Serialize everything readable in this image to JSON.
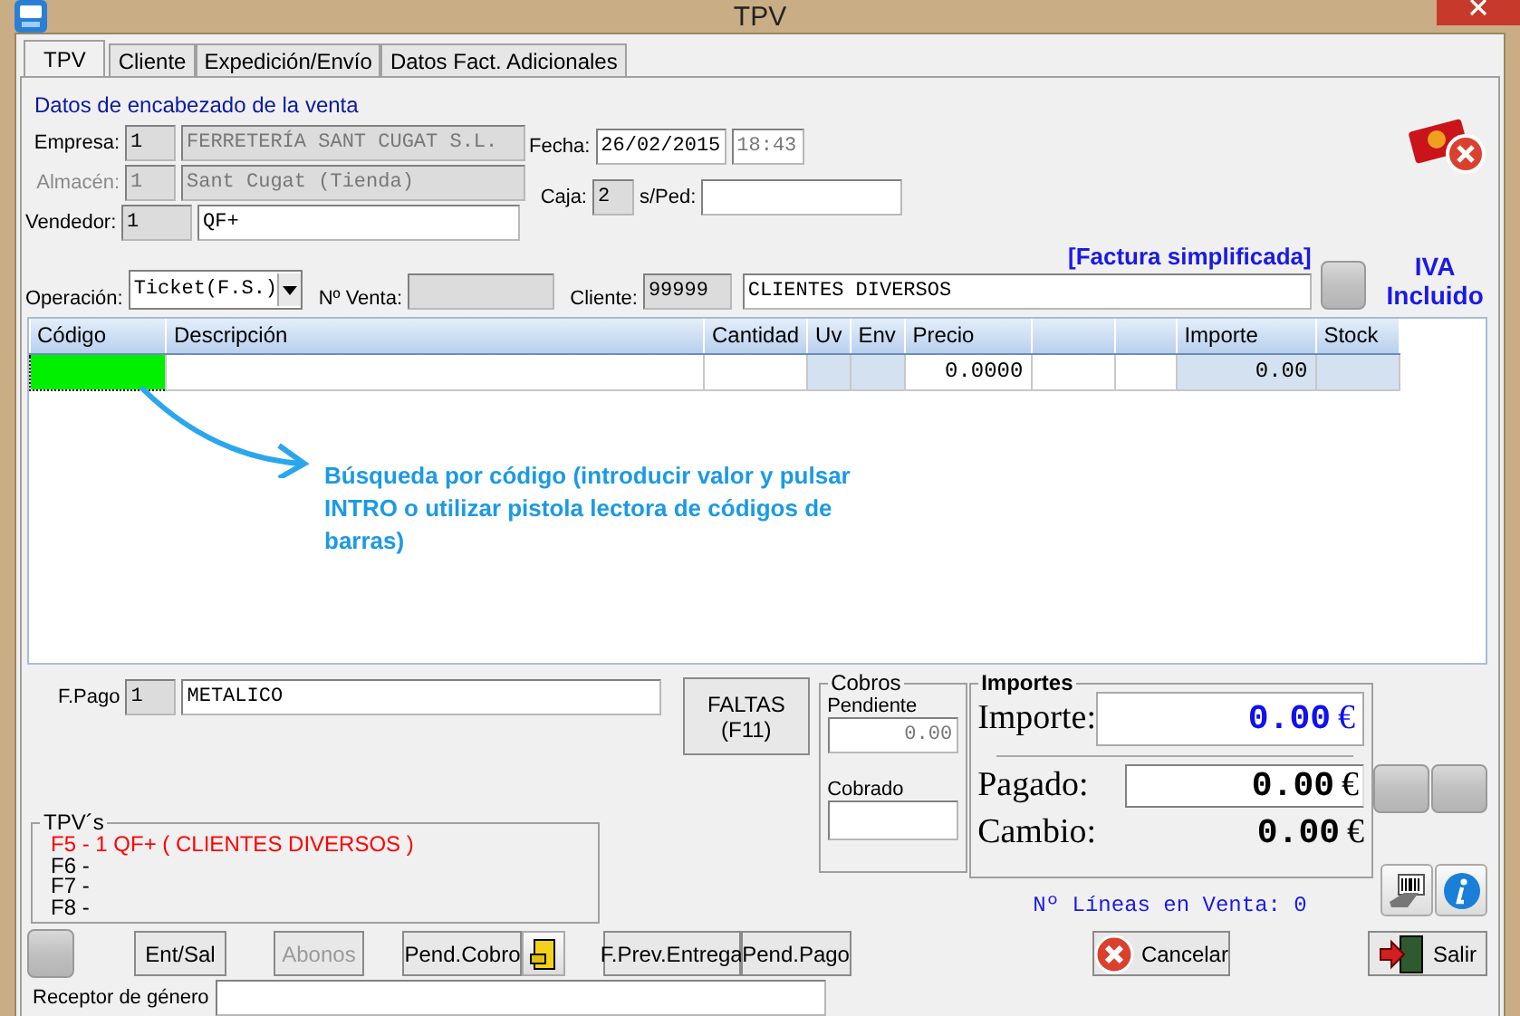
{
  "window": {
    "title": "TPV"
  },
  "tabs": [
    {
      "label": "TPV",
      "selected": true
    },
    {
      "label": "Cliente",
      "selected": false
    },
    {
      "label": "Expedición/Envío",
      "selected": false
    },
    {
      "label": "Datos Fact. Adicionales",
      "selected": false
    }
  ],
  "header": {
    "title": "Datos de encabezado de la venta",
    "fields": [
      {
        "label": "Empresa:",
        "code": "1",
        "name": "FERRETERÍA SANT CUGAT S.L.",
        "disabled": false
      },
      {
        "label": "Almacén:",
        "code": "1",
        "name": "Sant Cugat (Tienda)",
        "disabled": true
      },
      {
        "label": "Vendedor:",
        "code": "1",
        "name": "QF+",
        "disabled": false
      }
    ],
    "fecha": {
      "label": "Fecha:",
      "date": "26/02/2015",
      "time": "18:43"
    },
    "caja": {
      "label": "Caja:",
      "value": "2"
    },
    "pedido": {
      "label": "s/Ped:"
    },
    "operacion": {
      "label": "Operación:",
      "value": "Ticket(F.S.)"
    },
    "num_venta": {
      "label": "Nº Venta:"
    },
    "cliente": {
      "label": "Cliente:",
      "code": "99999",
      "name": "CLIENTES DIVERSOS"
    },
    "invoice_type": "[Factura simplificada]",
    "iva": "IVA Incluido"
  },
  "table": {
    "columns": [
      {
        "label": "Código"
      },
      {
        "label": "Descripción"
      },
      {
        "label": "Cantidad"
      },
      {
        "label": "Uv"
      },
      {
        "label": "Env"
      },
      {
        "label": "Precio"
      },
      {},
      {},
      {
        "label": "Importe"
      },
      {
        "label": "Stock"
      }
    ],
    "rows": [
      {
        "cells": [
          null,
          null,
          null,
          null,
          null,
          "0.0000",
          null,
          null,
          "0.00",
          null
        ]
      }
    ],
    "hint": "Búsqueda por código (introducir valor y pulsar INTRO o utilizar pistola lectora de códigos de barras)"
  },
  "payment": {
    "label": "F.Pago",
    "code": "1",
    "name": "METALICO"
  },
  "faltas_button": "FALTAS (F11)",
  "cobros": {
    "title": "Cobros",
    "pendiente_label": "Pendiente",
    "pendiente": "0.00",
    "cobrado_label": "Cobrado"
  },
  "importes": {
    "title": "Importes",
    "rows": [
      {
        "kind": "total",
        "label": "Importe:",
        "value": "0.00",
        "currency": "€"
      },
      {
        "kind": "input",
        "label": "Pagado:",
        "value": "0.00",
        "currency": "€"
      },
      {
        "kind": "plain",
        "label": "Cambio:",
        "value": "0.00",
        "currency": "€"
      }
    ]
  },
  "lines_count": "Nº Líneas en Venta: 0",
  "tpvs": {
    "title": "TPV´s",
    "items": [
      {
        "label": "F5 - 1 QF+ ( CLIENTES DIVERSOS )",
        "selected": true
      },
      {
        "label": "F6 -",
        "selected": false
      },
      {
        "label": "F7 -",
        "selected": false
      },
      {
        "label": "F8 -",
        "selected": false
      }
    ]
  },
  "buttons": [
    {
      "label": "Ent/Sal",
      "disabled": false
    },
    {
      "label": "Abonos",
      "disabled": true
    },
    {
      "label": "Pend.Cobro",
      "disabled": false
    },
    {
      "label": "F.Prev.Entrega",
      "disabled": false
    },
    {
      "label": "Pend.Pago",
      "disabled": false
    }
  ],
  "cancel_button": "Cancelar",
  "exit_button": "Salir",
  "receptor": {
    "label": "Receptor de género"
  }
}
